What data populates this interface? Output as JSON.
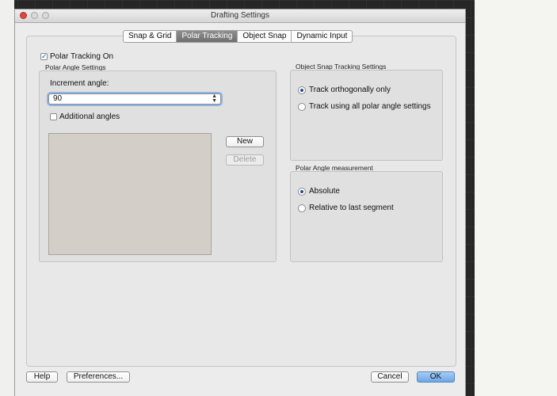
{
  "window": {
    "title": "Drafting Settings"
  },
  "tabs": [
    {
      "label": "Snap & Grid",
      "active": false
    },
    {
      "label": "Polar Tracking",
      "active": true
    },
    {
      "label": "Object Snap",
      "active": false
    },
    {
      "label": "Dynamic Input",
      "active": false
    }
  ],
  "polar_tracking": {
    "enabled_label": "Polar Tracking On",
    "enabled": true,
    "angle_settings": {
      "group_label": "Polar Angle Settings",
      "increment_label": "Increment angle:",
      "increment_value": "90",
      "additional_label": "Additional angles",
      "additional_checked": false,
      "new_button": "New",
      "delete_button": "Delete"
    }
  },
  "object_snap_tracking": {
    "group_label": "Object Snap Tracking Settings",
    "options": [
      {
        "label": "Track orthogonally only",
        "selected": true
      },
      {
        "label": "Track using all polar angle settings",
        "selected": false
      }
    ]
  },
  "polar_measurement": {
    "group_label": "Polar Angle measurement",
    "options": [
      {
        "label": "Absolute",
        "selected": true
      },
      {
        "label": "Relative to last segment",
        "selected": false
      }
    ]
  },
  "footer": {
    "help": "Help",
    "preferences": "Preferences...",
    "cancel": "Cancel",
    "ok": "OK"
  },
  "colors": {
    "accent": "#6da6e6",
    "close_button": "#e0463f",
    "list_background": "#d3cec8"
  }
}
